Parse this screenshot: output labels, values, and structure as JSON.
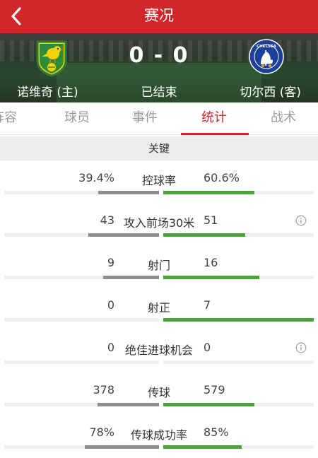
{
  "header": {
    "title": "赛况",
    "back_icon": "chevron-left-icon"
  },
  "match": {
    "home_team": "诺维奇 (主)",
    "away_team": "切尔西 (客)",
    "score": "0 - 0",
    "status": "已结束",
    "home_badge_icon": "norwich-crest-icon",
    "away_badge_icon": "chelsea-crest-icon",
    "away_badge_text": "CHELSEA"
  },
  "tabs": [
    {
      "label": "阵容"
    },
    {
      "label": "球员"
    },
    {
      "label": "事件"
    },
    {
      "label": "统计",
      "active": true
    },
    {
      "label": "战术"
    }
  ],
  "section": {
    "title": "关键"
  },
  "colors": {
    "accent": "#d3262b",
    "home_bar": "#8e8e8e",
    "away_bar": "#4aa436",
    "track": "#efefef"
  },
  "stats": [
    {
      "label": "控球率",
      "home": "39.4%",
      "away": "60.6%",
      "home_share": 0.394,
      "away_share": 0.606,
      "info": false
    },
    {
      "label": "攻入前场30米",
      "home": "43",
      "away": "51",
      "home_share": 0.457,
      "away_share": 0.543,
      "info": true
    },
    {
      "label": "射门",
      "home": "9",
      "away": "16",
      "home_share": 0.36,
      "away_share": 0.64,
      "info": false
    },
    {
      "label": "射正",
      "home": "0",
      "away": "7",
      "home_share": 0.0,
      "away_share": 1.0,
      "info": false
    },
    {
      "label": "绝佳进球机会",
      "home": "0",
      "away": "0",
      "home_share": 0.0,
      "away_share": 0.0,
      "info": true
    },
    {
      "label": "传球",
      "home": "378",
      "away": "579",
      "home_share": 0.395,
      "away_share": 0.605,
      "info": false
    },
    {
      "label": "传球成功率",
      "home": "78%",
      "away": "85%",
      "home_share": 0.479,
      "away_share": 0.521,
      "info": false
    }
  ]
}
